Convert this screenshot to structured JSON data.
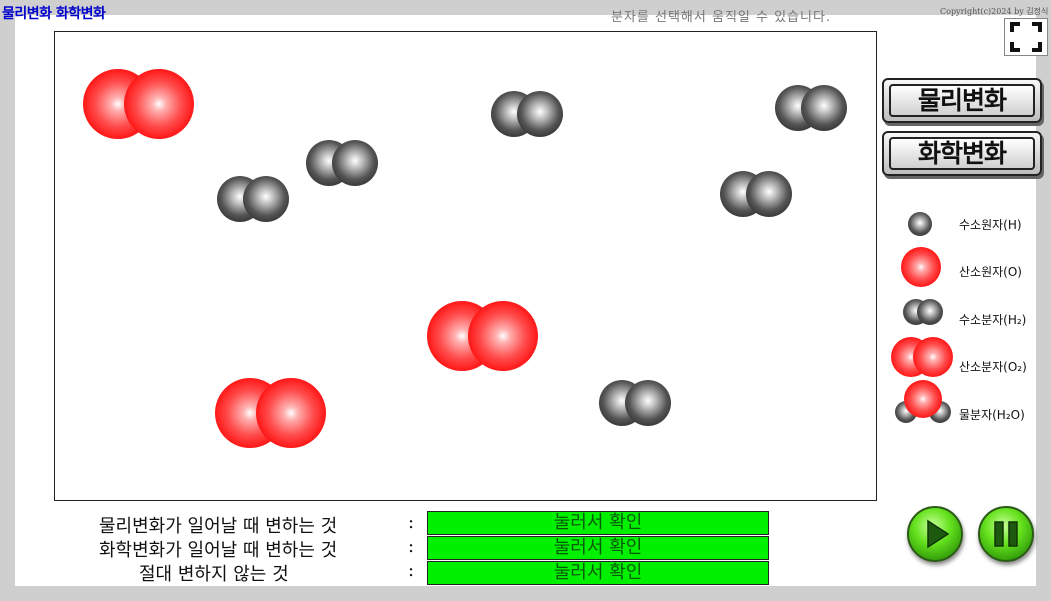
{
  "app": {
    "title": "물리변화 화학변화",
    "hint": "분자를 선택해서  움직일 수 있습니다.",
    "copyright": "Copyright(c)2024 by 김정식"
  },
  "icons": {
    "fullscreen": "fullscreen-icon",
    "play": "play-icon",
    "pause": "pause-icon"
  },
  "buttons": {
    "physical": "물리변화",
    "chemical": "화학변화"
  },
  "legend": {
    "h_atom": "수소원자(H)",
    "o_atom": "산소원자(O)",
    "h2": "수소분자(H₂)",
    "o2": "산소분자(O₂)",
    "h2o": "물분자(H₂O)"
  },
  "questions": [
    {
      "label": "물리변화가 일어날 때 변하는 것",
      "colon": ":",
      "answer": "눌러서 확인"
    },
    {
      "label": "화학변화가 일어날 때 변하는 것",
      "colon": ":",
      "answer": "눌러서 확인"
    },
    {
      "label": "절대 변하지 않는 것",
      "colon": ":",
      "answer": "눌러서 확인"
    }
  ],
  "colors": {
    "title": "#0000cc",
    "hydrogen": "#333333",
    "oxygen": "#ff2020",
    "answer_bg": "#00f000",
    "control": "#55cc22"
  }
}
